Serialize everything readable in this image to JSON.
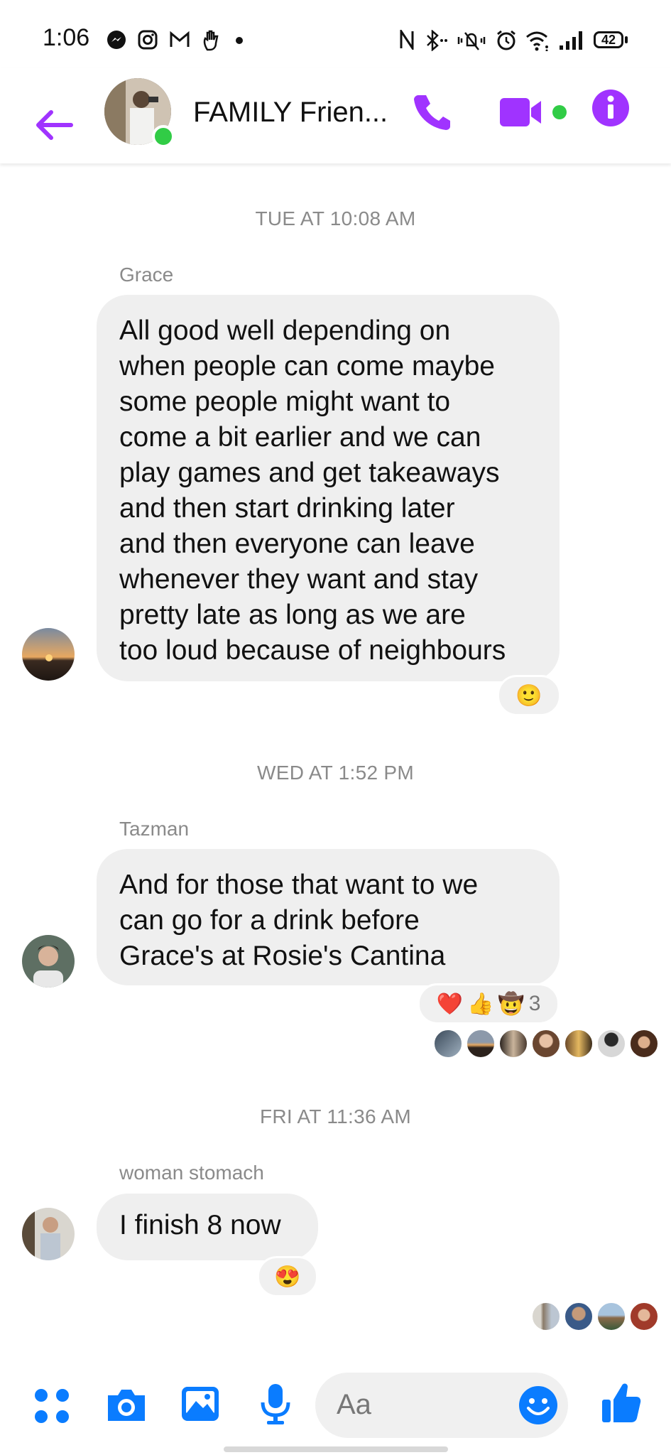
{
  "status_bar": {
    "time": "1:06",
    "battery": "42"
  },
  "header": {
    "title": "FAMILY Frien..."
  },
  "colors": {
    "accent": "#a033ff",
    "online": "#31cc46",
    "bubble": "#efefef",
    "composer_icon": "#0a7cff"
  },
  "messages": [
    {
      "timestamp": "TUE AT 10:08 AM",
      "sender": "Grace",
      "lines": [
        "All good well depending on",
        "when people can come maybe",
        "some people might want to",
        "come a bit earlier and we can",
        "play games and get takeaways",
        "and then start drinking later",
        "and then everyone can leave",
        "whenever they want and stay",
        "pretty late as long as we are",
        "too loud because of neighbours"
      ],
      "reactions": [
        "🙂"
      ]
    },
    {
      "timestamp": "WED AT 1:52 PM",
      "sender": "Tazman",
      "lines": [
        "And for those that want to we",
        "can go for a drink before",
        "Grace's at Rosie's Cantina"
      ],
      "reactions": [
        "❤️",
        "👍",
        "🤠"
      ],
      "reaction_count": "3"
    },
    {
      "timestamp": "FRI AT 11:36 AM",
      "sender": "woman stomach",
      "lines": [
        "I finish 8 now"
      ],
      "reactions": [
        "😍"
      ]
    }
  ],
  "composer": {
    "placeholder": "Aa"
  },
  "icons": [
    "back-arrow-icon",
    "phone-icon",
    "video-camera-icon",
    "info-icon",
    "apps-icon",
    "camera-icon",
    "gallery-icon",
    "microphone-icon",
    "emoji-icon",
    "thumbs-up-icon"
  ]
}
